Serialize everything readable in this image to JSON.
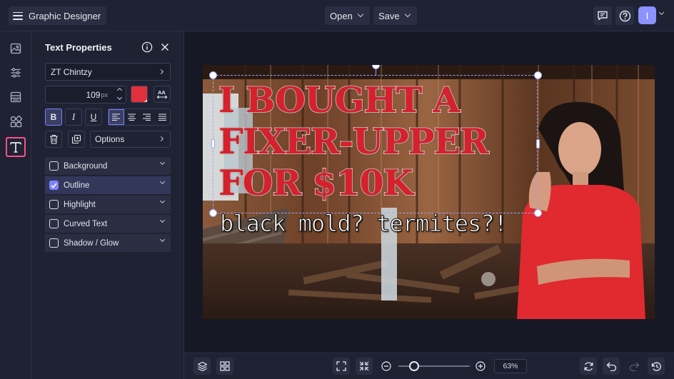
{
  "header": {
    "app_title": "Graphic Designer",
    "open_label": "Open",
    "save_label": "Save",
    "avatar_initial": "I"
  },
  "panel": {
    "title": "Text Properties",
    "font_name": "ZT Chintzy",
    "font_size": "109",
    "font_size_unit": "px",
    "text_color": "#e0303c",
    "options_label": "Options",
    "effects": [
      {
        "label": "Background",
        "checked": false
      },
      {
        "label": "Outline",
        "checked": true
      },
      {
        "label": "Highlight",
        "checked": false
      },
      {
        "label": "Curved Text",
        "checked": false
      },
      {
        "label": "Shadow / Glow",
        "checked": false
      }
    ]
  },
  "canvas": {
    "headline_lines": [
      "I BOUGHT A",
      "FIXER-UPPER",
      "FOR $10K"
    ],
    "subline": "black mold? termites?!"
  },
  "bottom": {
    "zoom": "63%",
    "zoom_fraction": 0.22
  },
  "colors": {
    "accent": "#7c83ff",
    "active_tool": "#ff4f8b",
    "headline_fill": "#d6202b"
  }
}
